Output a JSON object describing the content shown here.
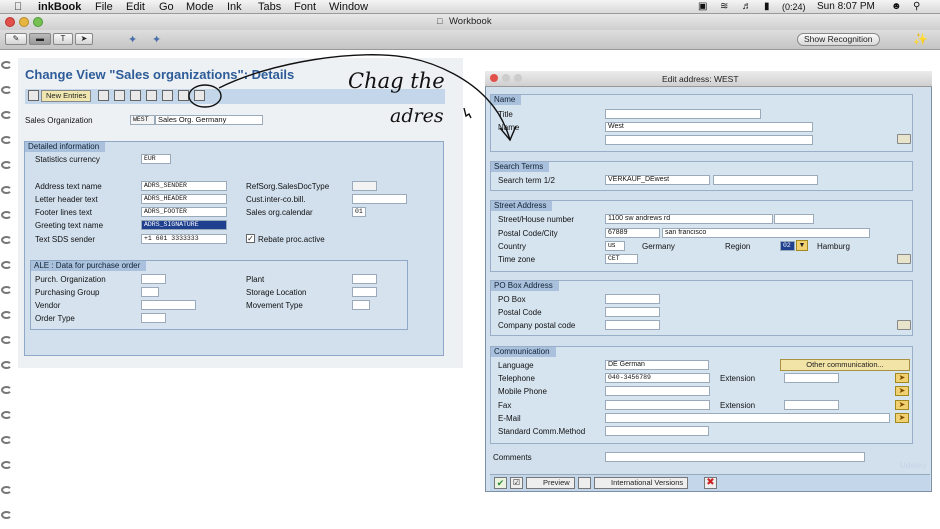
{
  "menubar": {
    "app": "inkBook",
    "items": [
      "File",
      "Edit",
      "Go",
      "Mode",
      "Ink",
      "Tabs",
      "Font",
      "Window"
    ],
    "battery": "(0:24)",
    "clock": "Sun 8:07 PM"
  },
  "window": {
    "title": "Workbook",
    "show_recognition": "Show Recognition"
  },
  "main": {
    "title": "Change View \"Sales organizations\": Details",
    "new_entries": "New Entries",
    "sales_org_label": "Sales Organization",
    "sales_org_code": "WEST",
    "sales_org_name": "Sales Org. Germany",
    "detailed_tab": "Detailed information",
    "stats_currency_label": "Statistics currency",
    "stats_currency": "EUR",
    "address_text_label": "Address text name",
    "address_text": "ADRS_SENDER",
    "letter_header_label": "Letter header text",
    "letter_header": "ADRS_HEADER",
    "footer_lines_label": "Footer lines text",
    "footer_lines": "ADRS_FOOTER",
    "greeting_label": "Greeting text name",
    "greeting": "ADRS_SIGNATURE",
    "text_sds_label": "Text SDS sender",
    "text_sds": "+1 601 3333333",
    "refsorg_label": "RefSorg.SalesDocType",
    "cust_inter_label": "Cust.inter-co.bill.",
    "sales_cal_label": "Sales org.calendar",
    "sales_cal": "01",
    "rebate_label": "Rebate proc.active",
    "ale_tab": "ALE : Data for purchase order",
    "purch_org_label": "Purch. Organization",
    "purch_group_label": "Purchasing Group",
    "vendor_label": "Vendor",
    "order_type_label": "Order Type",
    "plant_label": "Plant",
    "storage_label": "Storage Location",
    "movement_label": "Movement Type"
  },
  "ink": {
    "line1": "Chag the",
    "line2": "adres"
  },
  "dialog": {
    "title": "Edit address:  WEST",
    "name_tab": "Name",
    "title_label": "Title",
    "name_label": "Name",
    "name_value": "West",
    "search_tab": "Search Terms",
    "search_label": "Search term 1/2",
    "search_value": "VERKAUF_DEwest",
    "street_tab": "Street Address",
    "street_label": "Street/House number",
    "street_value": "1100 sw andrews rd",
    "postal_label": "Postal Code/City",
    "postal_value": "67889",
    "city_value": "san francisco",
    "country_label": "Country",
    "country_code": "us",
    "country_name": "Germany",
    "region_label": "Region",
    "region_code": "02",
    "region_name": "Hamburg",
    "timezone_label": "Time zone",
    "timezone_value": "CET",
    "pobox_tab": "PO Box Address",
    "pobox_label": "PO Box",
    "pobox_postal_label": "Postal Code",
    "company_postal_label": "Company postal code",
    "comm_tab": "Communication",
    "language_label": "Language",
    "language_value": "DE  German",
    "other_comm": "Other communication...",
    "telephone_label": "Telephone",
    "telephone_value": "040-3456789",
    "extension_label": "Extension",
    "mobile_label": "Mobile Phone",
    "fax_label": "Fax",
    "fax_extension_label": "Extension",
    "email_label": "E-Mail",
    "std_comm_label": "Standard Comm.Method",
    "comments_label": "Comments",
    "preview": "Preview",
    "intl_versions": "International Versions"
  },
  "watermark": "Udemy"
}
